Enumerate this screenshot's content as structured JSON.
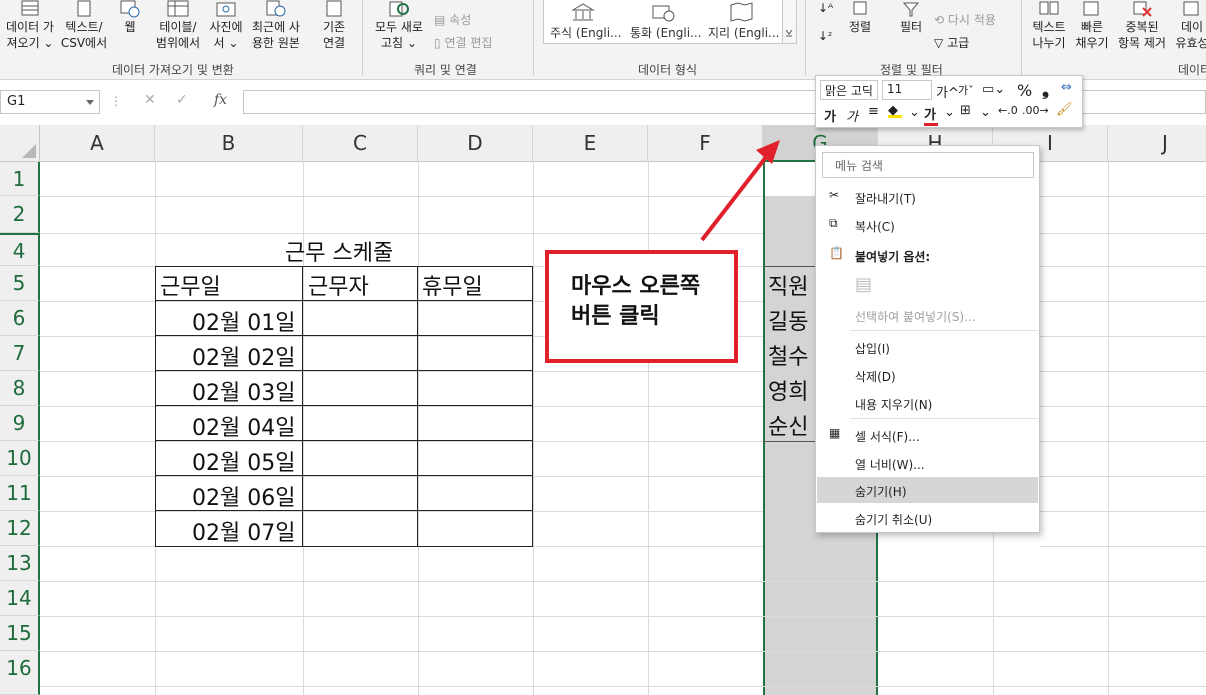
{
  "ribbon": {
    "buttons": {
      "get_data": "데이터 가\n져오기 ⌄",
      "text_csv": "텍스트/\nCSV에서",
      "web": "웹",
      "table_range": "테이블/\n범위에서",
      "from_picture": "사진에\n서 ⌄",
      "recent_sources": "최근에 사\n용한 원본",
      "existing_conn": "기존\n연결",
      "refresh_all": "모두 새로\n고침 ⌄",
      "properties": "속성",
      "edit_links": "연결 편집",
      "sort": "정렬",
      "filter": "필터",
      "reapply": "다시 적용",
      "advanced": "고급",
      "text_to_columns": "텍스트\n나누기",
      "flash_fill": "빠른\n채우기",
      "remove_duplicates": "중복된\n항목 제거",
      "data_validation": "데이\n유효성"
    },
    "data_types": [
      "주식 (Engli...",
      "통화 (Engli...",
      "지리 (Engli..."
    ],
    "groups": {
      "get_transform": "데이터 가져오기 및 변환",
      "queries": "쿼리 및 연결",
      "data_types": "데이터 형식",
      "sort_filter": "정렬 및 필터",
      "data_tools": "데이터"
    }
  },
  "formula_bar": {
    "name_box": "G1",
    "fx": "fx",
    "value": ""
  },
  "grid": {
    "columns": [
      "A",
      "B",
      "C",
      "D",
      "E",
      "F",
      "G",
      "H",
      "I",
      "J"
    ],
    "rows": [
      "1",
      "2",
      "4",
      "5",
      "6",
      "7",
      "8",
      "9",
      "10",
      "11",
      "12",
      "13",
      "14",
      "15",
      "16"
    ],
    "selected_column": "G",
    "title": "근무 스케줄",
    "headers": [
      "근무일",
      "근무자",
      "휴무일"
    ],
    "dates": [
      "02월 01일",
      "02월 02일",
      "02월 03일",
      "02월 04일",
      "02월 05일",
      "02월 06일",
      "02월 07일"
    ],
    "staff_header": "직원",
    "staff": [
      "길동",
      "철수",
      "영희",
      "순신"
    ]
  },
  "annotation": {
    "line1": "마우스 오른쪽",
    "line2": "버튼 클릭",
    "color": "#e0202a"
  },
  "mini_toolbar": {
    "font_name": "맑은 고딕",
    "font_size": "11",
    "grow": "가",
    "shrink": "가",
    "percent": "%",
    "comma": "❟",
    "bold": "가",
    "italic": "가",
    "font_color_glyph": "가"
  },
  "context_menu": {
    "search_placeholder": "메뉴 검색",
    "items": {
      "cut": "잘라내기(T)",
      "copy": "복사(C)",
      "paste_options": "붙여넣기 옵션:",
      "paste_special": "선택하여 붙여넣기(S)...",
      "insert": "삽입(I)",
      "delete": "삭제(D)",
      "clear": "내용 지우기(N)",
      "format_cells": "셀 서식(F)...",
      "col_width": "열 너비(W)...",
      "hide": "숨기기(H)",
      "unhide": "숨기기 취소(U)"
    },
    "highlighted": "hide"
  },
  "colors": {
    "accent_green": "#217346",
    "annotation_red": "#e0202a",
    "selection_gray": "#d4d4d4"
  }
}
